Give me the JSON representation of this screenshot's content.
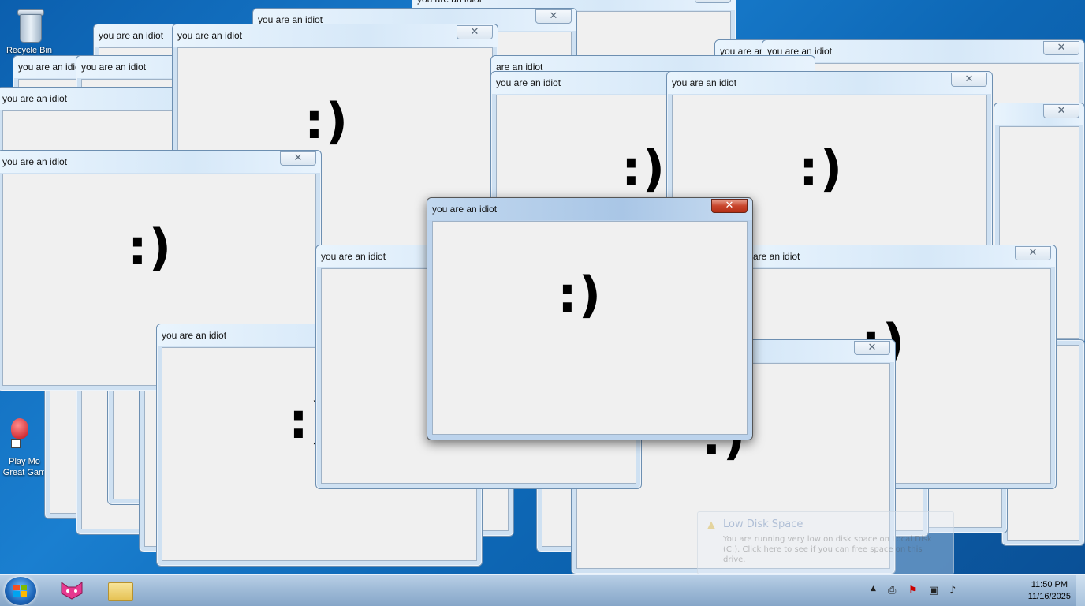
{
  "desktop": {
    "icons": [
      {
        "label": "Recycle Bin"
      },
      {
        "label_line1": "Play Mo",
        "label_line2": "Great Gam"
      }
    ]
  },
  "window_title": "you are an idiot",
  "partial_titles": {
    "are_an_idiot": "are an idiot",
    "you_are_an": "you are an"
  },
  "smiley": ":)",
  "close_glyph": "✕",
  "toast": {
    "title": "Low Disk Space",
    "body": "You are running very low on disk space on Local Disk (C:). Click here to see if you can free space on this drive."
  },
  "taskbar": {
    "time": "11:50 PM",
    "date": "11/16/2025"
  },
  "colors": {
    "desktop": "#0d67b5",
    "client": "#f0f0f0",
    "active_close": "#c8452c"
  }
}
